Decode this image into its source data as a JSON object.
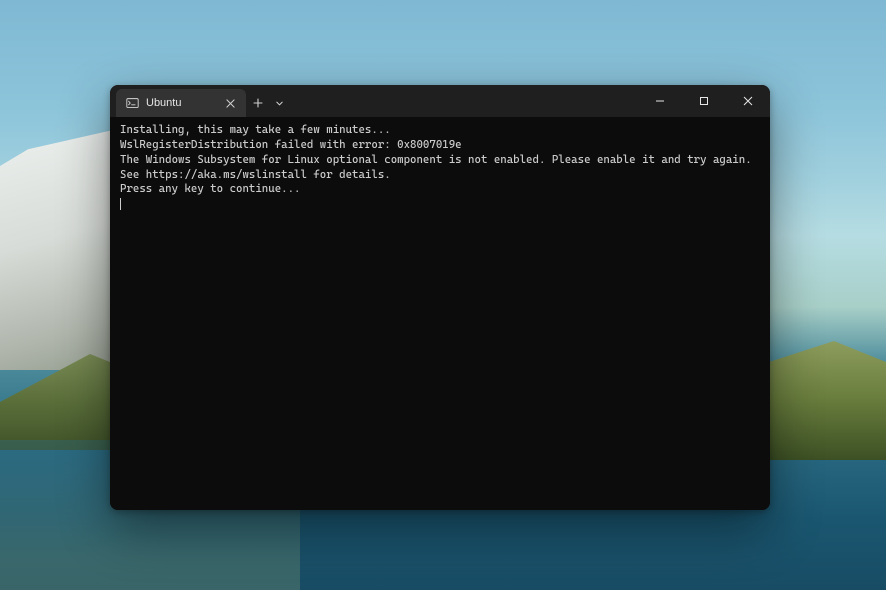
{
  "desktop": {
    "description": "Windows 11 landscape wallpaper with mountains, grass and lake reflection"
  },
  "window": {
    "app_icon": "terminal-icon",
    "tabs": [
      {
        "icon": "ubuntu-icon",
        "title": "Ubuntu",
        "active": true
      }
    ],
    "new_tab_glyph": "+",
    "dropdown_glyph": "⌄",
    "controls": {
      "minimize": "minimize",
      "maximize": "maximize",
      "close": "close"
    }
  },
  "terminal": {
    "lines": [
      "Installing, this may take a few minutes...",
      "WslRegisterDistribution failed with error: 0x8007019e",
      "The Windows Subsystem for Linux optional component is not enabled. Please enable it and try again.",
      "See https://aka.ms/wslinstall for details.",
      "Press any key to continue..."
    ]
  }
}
